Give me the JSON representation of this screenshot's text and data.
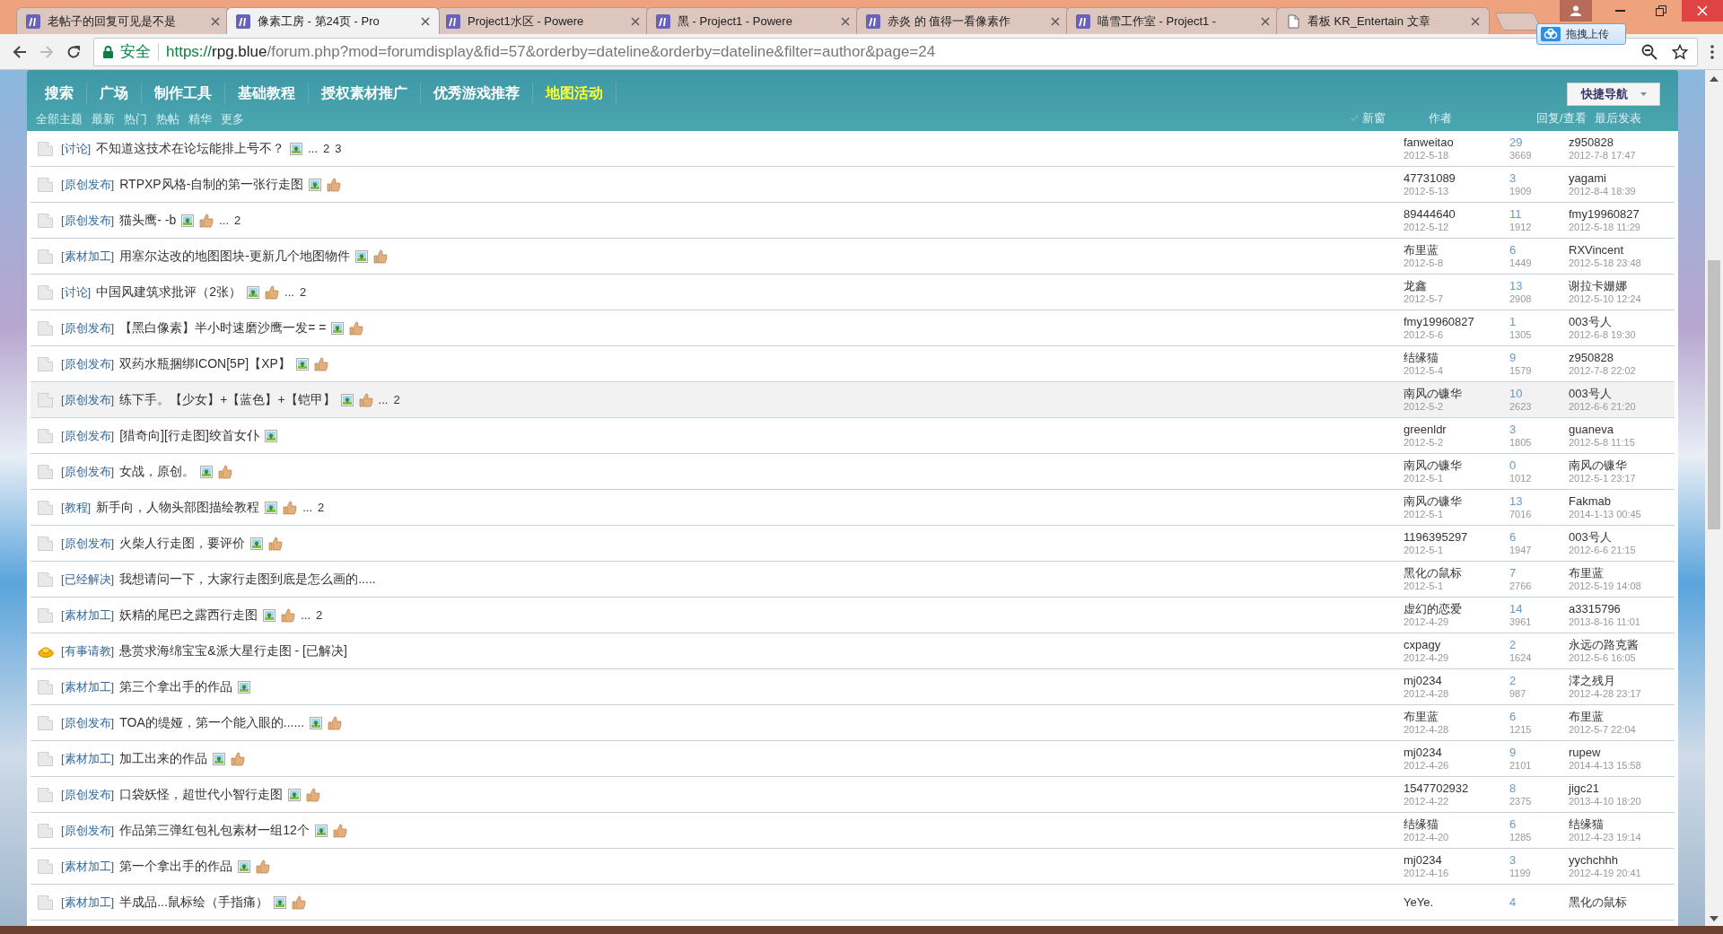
{
  "browser": {
    "tabs": [
      {
        "kind": "site",
        "title": "老帖子的回复可见是不是",
        "selected": false
      },
      {
        "kind": "site",
        "title": "像素工房 - 第24页 - Pro",
        "selected": true
      },
      {
        "kind": "site",
        "title": "Project1水区 - Powere",
        "selected": false
      },
      {
        "kind": "site",
        "title": "黑 - Project1 - Powere",
        "selected": false
      },
      {
        "kind": "site",
        "title": "赤炎 的 值得一看像素作",
        "selected": false
      },
      {
        "kind": "site",
        "title": "喵雪工作室 - Project1 -",
        "selected": false
      },
      {
        "kind": "page",
        "title": "看板 KR_Entertain 文章",
        "selected": false
      }
    ],
    "upload_button": "拖拽上传",
    "address": {
      "security": "安全",
      "scheme": "https://",
      "host": "rpg.blue",
      "path": "/forum.php?mod=forumdisplay&fid=57&orderby=dateline&orderby=dateline&filter=author&page=24"
    }
  },
  "nav": {
    "items": [
      {
        "label": "搜索",
        "selected": false
      },
      {
        "label": "广场",
        "selected": false
      },
      {
        "label": "制作工具",
        "selected": false
      },
      {
        "label": "基础教程",
        "selected": false
      },
      {
        "label": "授权素材推广",
        "selected": false
      },
      {
        "label": "优秀游戏推荐",
        "selected": false
      },
      {
        "label": "地图活动",
        "selected": true
      }
    ],
    "filters": [
      "全部主题",
      "最新",
      "热门",
      "热帖",
      "精华",
      "更多"
    ],
    "quick_nav": "快捷导航"
  },
  "list_header": {
    "new_window": "新窗",
    "author": "作者",
    "replies_views": "回复/查看",
    "last_post": "最后发表"
  },
  "threads": [
    {
      "kind": "normal",
      "tag": "[讨论]",
      "title": "不知道这技术在论坛能排上号不？",
      "image": true,
      "liked": false,
      "ellipsis": "...",
      "pages": [
        "2",
        "3"
      ],
      "author": "fanweitao",
      "date": "2012-5-18",
      "replies": "29",
      "views": "3669",
      "last_poster": "z950828",
      "last_time": "2012-7-8 17:47",
      "hovered": false
    },
    {
      "kind": "normal",
      "tag": "[原创发布]",
      "title": "RTPXP风格-自制的第一张行走图",
      "image": true,
      "liked": true,
      "author": "47731089",
      "date": "2012-5-13",
      "replies": "3",
      "views": "1909",
      "last_poster": "yagami",
      "last_time": "2012-8-4 18:39",
      "hovered": false
    },
    {
      "kind": "normal",
      "tag": "[原创发布]",
      "title": "猫头鹰- -b",
      "image": true,
      "liked": true,
      "ellipsis": "...",
      "pages": [
        "2"
      ],
      "author": "89444640",
      "date": "2012-5-12",
      "replies": "11",
      "views": "1912",
      "last_poster": "fmy19960827",
      "last_time": "2012-5-18 11:29",
      "hovered": false
    },
    {
      "kind": "normal",
      "tag": "[素材加工]",
      "title": "用塞尔达改的地图图块-更新几个地图物件",
      "image": true,
      "liked": true,
      "author": "布里蓝",
      "date": "2012-5-8",
      "replies": "6",
      "views": "1449",
      "last_poster": "RXVincent",
      "last_time": "2012-5-18 23:48",
      "hovered": false
    },
    {
      "kind": "normal",
      "tag": "[讨论]",
      "title": "中国风建筑求批评（2张）",
      "image": true,
      "liked": true,
      "ellipsis": "...",
      "pages": [
        "2"
      ],
      "author": "龙鑫",
      "date": "2012-5-7",
      "replies": "13",
      "views": "2908",
      "last_poster": "谢拉卡姗娜",
      "last_time": "2012-5-10 12:24",
      "hovered": false
    },
    {
      "kind": "normal",
      "tag": "[原创发布]",
      "title": "【黑白像素】半小时速磨沙鹰一发= =",
      "image": true,
      "liked": true,
      "author": "fmy19960827",
      "date": "2012-5-6",
      "replies": "1",
      "views": "1305",
      "last_poster": "003号人",
      "last_time": "2012-6-8 19:30",
      "hovered": false
    },
    {
      "kind": "normal",
      "tag": "[原创发布]",
      "title": "双药水瓶捆绑ICON[5P]【XP】",
      "image": true,
      "liked": true,
      "author": "结缘猫",
      "date": "2012-5-4",
      "replies": "9",
      "views": "1579",
      "last_poster": "z950828",
      "last_time": "2012-7-8 22:02",
      "hovered": false
    },
    {
      "kind": "normal",
      "tag": "[原创发布]",
      "title": "练下手。【少女】+【蓝色】+【铠甲】",
      "image": true,
      "liked": true,
      "ellipsis": "...",
      "pages": [
        "2"
      ],
      "author": "南风の镰华",
      "date": "2012-5-2",
      "replies": "10",
      "views": "2623",
      "last_poster": "003号人",
      "last_time": "2012-6-6 21:20",
      "hovered": true
    },
    {
      "kind": "normal",
      "tag": "[原创发布]",
      "title": "[猎奇向][行走图]绞首女仆",
      "image": true,
      "liked": false,
      "author": "greenldr",
      "date": "2012-5-2",
      "replies": "3",
      "views": "1805",
      "last_poster": "guaneva",
      "last_time": "2012-5-8 11:15",
      "hovered": false
    },
    {
      "kind": "normal",
      "tag": "[原创发布]",
      "title": "女战，原创。",
      "image": true,
      "liked": true,
      "author": "南风の镰华",
      "date": "2012-5-1",
      "replies": "0",
      "views": "1012",
      "last_poster": "南风の镰华",
      "last_time": "2012-5-1 23:17",
      "hovered": false
    },
    {
      "kind": "normal",
      "tag": "[教程]",
      "title": "新手向，人物头部图描绘教程",
      "image": true,
      "liked": true,
      "ellipsis": "...",
      "pages": [
        "2"
      ],
      "author": "南风の镰华",
      "date": "2012-5-1",
      "replies": "13",
      "views": "7016",
      "last_poster": "Fakmab",
      "last_time": "2014-1-13 00:45",
      "hovered": false
    },
    {
      "kind": "normal",
      "tag": "[原创发布]",
      "title": "火柴人行走图，要评价",
      "image": true,
      "liked": true,
      "author": "1196395297",
      "date": "2012-5-1",
      "replies": "6",
      "views": "1947",
      "last_poster": "003号人",
      "last_time": "2012-6-6 21:15",
      "hovered": false
    },
    {
      "kind": "normal",
      "tag": "[已经解决]",
      "title": "我想请问一下，大家行走图到底是怎么画的.....",
      "image": false,
      "liked": false,
      "author": "黑化の鼠标",
      "date": "2012-5-1",
      "replies": "7",
      "views": "2766",
      "last_poster": "布里蓝",
      "last_time": "2012-5-19 14:08",
      "hovered": false
    },
    {
      "kind": "normal",
      "tag": "[素材加工]",
      "title": "妖精的尾巴之露西行走图",
      "image": true,
      "liked": true,
      "ellipsis": "...",
      "pages": [
        "2"
      ],
      "author": "虚幻的恋爱",
      "date": "2012-4-29",
      "replies": "14",
      "views": "3961",
      "last_poster": "a3315796",
      "last_time": "2013-8-16 11:01",
      "hovered": false
    },
    {
      "kind": "reward",
      "tag": "[有事请教]",
      "title": "悬赏求海绵宝宝&派大星行走图 - [已解决]",
      "image": false,
      "liked": false,
      "author": "cxpagy",
      "date": "2012-4-29",
      "replies": "2",
      "views": "1624",
      "last_poster": "永远の路克酱",
      "last_time": "2012-5-6 16:05",
      "hovered": false
    },
    {
      "kind": "normal",
      "tag": "[素材加工]",
      "title": "第三个拿出手的作品",
      "image": true,
      "liked": false,
      "author": "mj0234",
      "date": "2012-4-28",
      "replies": "2",
      "views": "987",
      "last_poster": "澪之残月",
      "last_time": "2012-4-28 23:17",
      "hovered": false
    },
    {
      "kind": "normal",
      "tag": "[原创发布]",
      "title": "TOA的缇娅，第一个能入眼的......",
      "image": true,
      "liked": true,
      "author": "布里蓝",
      "date": "2012-4-28",
      "replies": "6",
      "views": "1215",
      "last_poster": "布里蓝",
      "last_time": "2012-5-7 22:04",
      "hovered": false
    },
    {
      "kind": "normal",
      "tag": "[素材加工]",
      "title": "加工出来的作品",
      "image": true,
      "liked": true,
      "author": "mj0234",
      "date": "2012-4-26",
      "replies": "9",
      "views": "2101",
      "last_poster": "rupew",
      "last_time": "2014-4-13 15:58",
      "hovered": false
    },
    {
      "kind": "normal",
      "tag": "[原创发布]",
      "title": "口袋妖怪，超世代小智行走图",
      "image": true,
      "liked": true,
      "author": "1547702932",
      "date": "2012-4-22",
      "replies": "8",
      "views": "2375",
      "last_poster": "jigc21",
      "last_time": "2013-4-10 18:20",
      "hovered": false
    },
    {
      "kind": "normal",
      "tag": "[原创发布]",
      "title": "作品第三弹红包礼包素材一组12个",
      "image": true,
      "liked": true,
      "author": "结缘猫",
      "date": "2012-4-20",
      "replies": "6",
      "views": "1285",
      "last_poster": "结缘猫",
      "last_time": "2012-4-23 19:14",
      "hovered": false
    },
    {
      "kind": "normal",
      "tag": "[素材加工]",
      "title": "第一个拿出手的作品",
      "image": true,
      "liked": true,
      "author": "mj0234",
      "date": "2012-4-16",
      "replies": "3",
      "views": "1199",
      "last_poster": "yychchhh",
      "last_time": "2012-4-19 20:41",
      "hovered": false
    },
    {
      "kind": "normal",
      "tag": "[素材加工]",
      "title": "半成品...鼠标绘（手指痛）",
      "image": true,
      "liked": true,
      "author": "YeYe.",
      "replies": "4",
      "last_poster": "黑化の鼠标",
      "hovered": false
    }
  ]
}
